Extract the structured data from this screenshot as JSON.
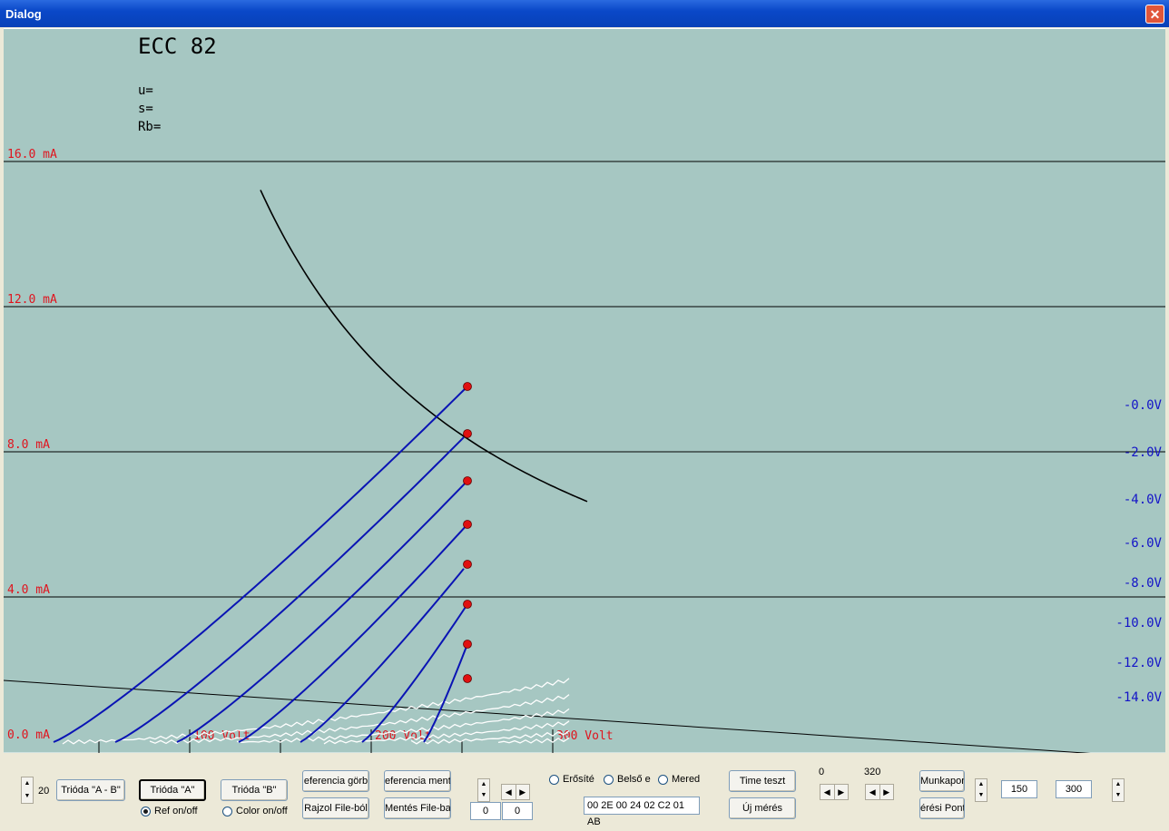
{
  "window": {
    "title": "Dialog",
    "close_glyph": "✕"
  },
  "chart_data": {
    "type": "line",
    "title": "ECC 82",
    "info_lines": [
      "u=",
      "s=",
      "Rb="
    ],
    "x_ticks": [
      "100 Volt",
      "200 Volt",
      "300 Volt"
    ],
    "y_ticks": [
      "0.0 mA",
      "4.0 mA",
      "8.0 mA",
      "12.0 mA",
      "16.0 mA"
    ],
    "xlim": [
      0,
      300
    ],
    "ylim": [
      0,
      16
    ],
    "grid": true,
    "series": [
      {
        "name": "-0.0V",
        "endpoint": [
          253,
          9.8
        ]
      },
      {
        "name": "-2.0V",
        "endpoint": [
          253,
          8.5
        ]
      },
      {
        "name": "-4.0V",
        "endpoint": [
          253,
          7.2
        ]
      },
      {
        "name": "-6.0V",
        "endpoint": [
          253,
          6.0
        ]
      },
      {
        "name": "-8.0V",
        "endpoint": [
          253,
          4.9
        ]
      },
      {
        "name": "-10.0V",
        "endpoint": [
          253,
          3.8
        ]
      },
      {
        "name": "-12.0V",
        "endpoint": [
          253,
          2.7
        ]
      },
      {
        "name": "-14.0V",
        "endpoint": [
          253,
          1.75
        ]
      }
    ],
    "colors": {
      "background": "#a6c7c2",
      "reference": "#ffffff",
      "measured": "#0a14b4",
      "axis_text": "#e0141e",
      "series_label": "#1414c8",
      "point": "#e01010"
    }
  },
  "controls": {
    "spin_value": "20",
    "btn_trioda_ab": "Trióda \"A - B\"",
    "btn_trioda_a": "Trióda  \"A\"",
    "btn_trioda_b": "Trióda  \"B\"",
    "radio_ref": "Ref on/off",
    "radio_color": "Color on/off",
    "btn_ref_gorbe": "eferencia görb",
    "btn_ref_mentes": "eferencia ment",
    "btn_rajzol": "Rajzol File-ból",
    "btn_mentes": "Mentés File-ba",
    "edit_a": "0",
    "edit_b": "0",
    "radio_erosites": "Erősíté",
    "radio_belso": "Belső e",
    "radio_meredek": "Mered",
    "hex_field": "00 2E 00 24 02 C2 01 AB",
    "btn_time": "Time teszt",
    "btn_uj": "Új mérés",
    "label_0": "0",
    "label_320": "320",
    "btn_munkapont": "Munkapon",
    "btn_meresi": "érési Pont",
    "edit_150": "150",
    "edit_300": "300"
  }
}
